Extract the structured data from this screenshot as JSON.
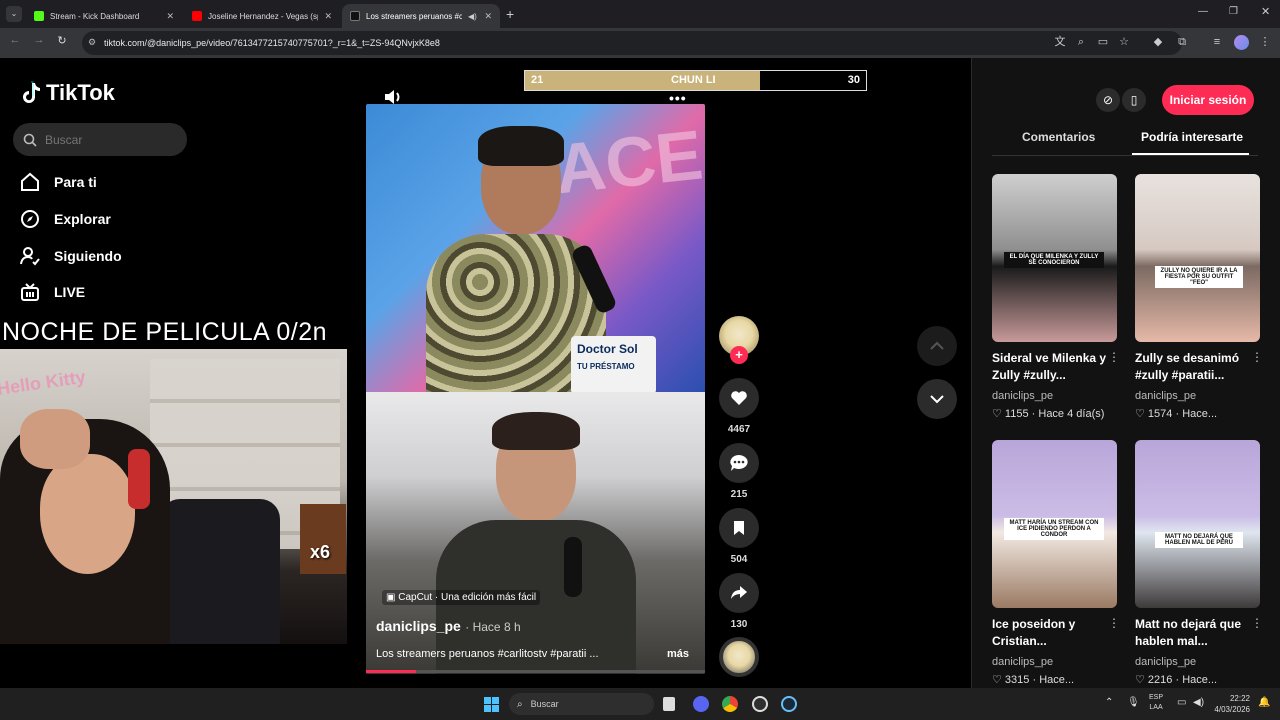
{
  "browser": {
    "tabs": [
      {
        "title": "Stream - Kick Dashboard",
        "favicon_color": "#53fc18",
        "active": false
      },
      {
        "title": "Joseline Hernandez - Vegas (sp",
        "favicon_color": "#ff0000",
        "active": false
      },
      {
        "title": "Los streamers peruanos #ca",
        "favicon_color": "#000000",
        "active": true
      }
    ],
    "url": "tiktok.com/@daniclips_pe/video/7613477215740775701?_r=1&_t=ZS-94QNvjxK8e8"
  },
  "sidebar": {
    "logo_text": "TikTok",
    "search_placeholder": "Buscar",
    "nav": [
      {
        "label": "Para ti",
        "icon": "home-icon"
      },
      {
        "label": "Explorar",
        "icon": "compass-icon"
      },
      {
        "label": "Siguiendo",
        "icon": "following-icon"
      },
      {
        "label": "LIVE",
        "icon": "live-icon"
      }
    ]
  },
  "overlay": {
    "title": "NOCHE DE PELICULA 0/2n",
    "badge": "x6"
  },
  "scoreboard": {
    "left_score": "21",
    "name": "CHUN LI",
    "right_score": "30",
    "fill_fraction": 0.69
  },
  "video": {
    "top_sign": "Doctor Sol",
    "top_sign_sub": "TU PRÉSTAMO",
    "capcut": "CapCut · Una edición más fácil",
    "author": "daniclips_pe",
    "time": "· Hace 8 h",
    "caption": "Los streamers peruanos #carlitostv #paratii ...",
    "more": "más"
  },
  "actions": {
    "likes": "4467",
    "comments": "215",
    "saves": "504",
    "shares": "130"
  },
  "right": {
    "login": "Iniciar sesión",
    "tabs": [
      "Comentarios",
      "Podría interesarte"
    ],
    "cards": [
      {
        "title": "Sideral ve Milenka y Zully #zully...",
        "user": "daniclips_pe",
        "likes": "1155",
        "time": "Hace 4 día(s)",
        "caption": "EL DÍA QUE MILENKA Y ZULLY SE CONOCIERON"
      },
      {
        "title": "Zully se desanimó #zully #paratii...",
        "user": "daniclips_pe",
        "likes": "1574",
        "time": "Hace...",
        "caption": "ZULLY NO QUIERE IR A LA FIESTA POR SU OUTFIT \"FEO\""
      },
      {
        "title": "Ice poseidon y Cristian...",
        "user": "daniclips_pe",
        "likes": "3315",
        "time": "Hace...",
        "caption": "MATT HARÍA UN STREAM CON ICE PIDIENDO PERDON A CONDOR"
      },
      {
        "title": "Matt no dejará que hablen mal...",
        "user": "daniclips_pe",
        "likes": "2216",
        "time": "Hace...",
        "caption": "MATT NO DEJARÁ QUE HABLEN MAL DE PERÚ"
      }
    ]
  },
  "taskbar": {
    "search": "Buscar",
    "lang": "ESP",
    "lang2": "LAA",
    "time": "22:22",
    "date": "4/03/2026"
  }
}
